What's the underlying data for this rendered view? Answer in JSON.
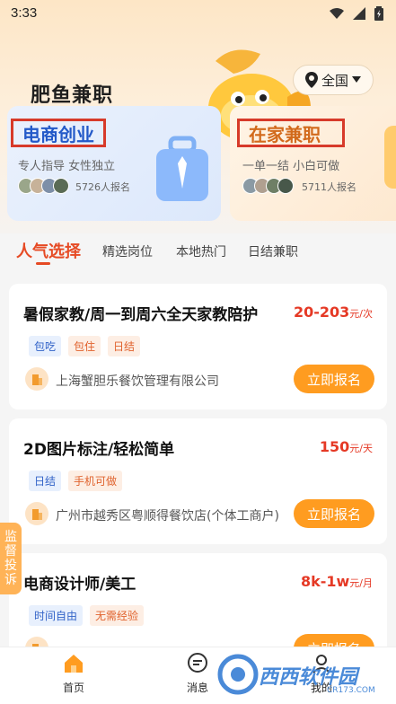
{
  "status": {
    "time": "3:33"
  },
  "header": {
    "title": "肥鱼兼职",
    "region": "全国"
  },
  "cards": [
    {
      "title": "电商创业",
      "subtitle": "专人指导 女性独立",
      "count": "5726人报名"
    },
    {
      "title": "在家兼职",
      "subtitle": "一单一结 小白可做",
      "count": "5711人报名"
    }
  ],
  "tabs": [
    "人气选择",
    "精选岗位",
    "本地热门",
    "日结兼职"
  ],
  "jobs": [
    {
      "title": "暑假家教/周一到周六全天家教陪护",
      "salary": "20-203",
      "unit": "元/次",
      "tags": [
        "包吃",
        "包住",
        "日结"
      ],
      "company": "上海蟹胆乐餐饮管理有限公司",
      "action": "立即报名"
    },
    {
      "title": "2D图片标注/轻松简单",
      "salary": "150",
      "unit": "元/天",
      "tags": [
        "日结",
        "手机可做"
      ],
      "company": "广州市越秀区粤顺得餐饮店(个体工商户)",
      "action": "立即报名"
    },
    {
      "title": "电商设计师/美工",
      "salary": "8k-1w",
      "unit": "元/月",
      "tags": [
        "时间自由",
        "无需经验"
      ],
      "company": "",
      "action": "立即报名"
    }
  ],
  "side": {
    "supervise": "监督投诉"
  },
  "nav": {
    "home": "首页",
    "messages": "消息",
    "mine": "我的"
  },
  "watermark": {
    "text": "西西软件园",
    "url": "CR173.COM"
  },
  "colors": {
    "accent": "#e64a24",
    "salary": "#e53925",
    "button": "#ff9c20"
  }
}
